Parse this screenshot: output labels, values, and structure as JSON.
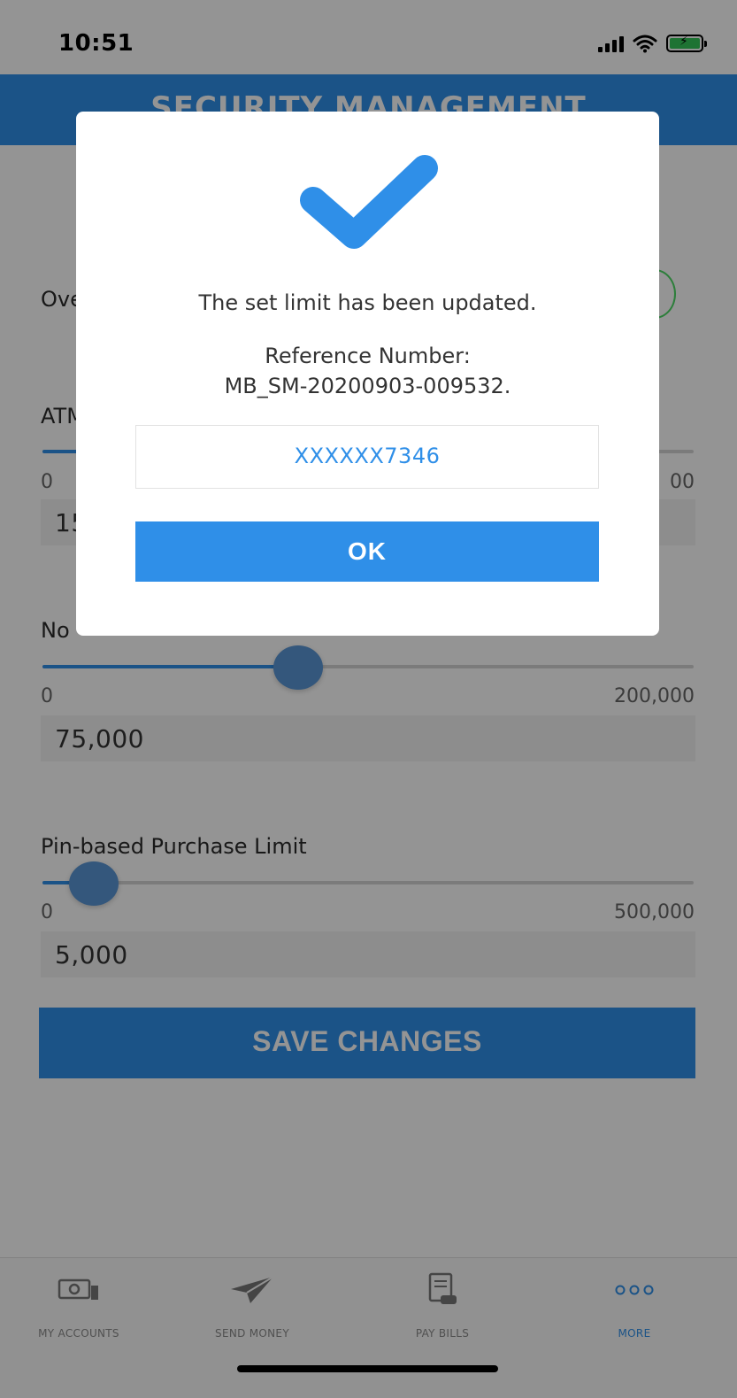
{
  "status_bar": {
    "time": "10:51"
  },
  "header": {
    "title": "SECURITY MANAGEMENT"
  },
  "overall": {
    "label_partial": "Ove"
  },
  "atm": {
    "label_partial": "ATM",
    "min": "0",
    "max_partial": "00",
    "value_partial": "15"
  },
  "no_pin": {
    "label_partial": "No",
    "min": "0",
    "max": "200,000",
    "value": "75,000",
    "fraction": 0.375
  },
  "pin_purchase": {
    "label": "Pin-based Purchase Limit",
    "min": "0",
    "max": "500,000",
    "value": "5,000",
    "fraction": 0.01
  },
  "save_button": {
    "label": "SAVE CHANGES"
  },
  "nav": {
    "items": [
      {
        "label": "MY ACCOUNTS",
        "icon": "money-icon"
      },
      {
        "label": "SEND MONEY",
        "icon": "paper-plane-icon"
      },
      {
        "label": "PAY BILLS",
        "icon": "bill-icon"
      },
      {
        "label": "MORE",
        "icon": "more-dots-icon"
      }
    ]
  },
  "modal": {
    "icon": "checkmark-icon",
    "message": "The set limit has been updated.",
    "ref_label": "Reference Number:",
    "ref_number": "MB_SM-20200903-009532.",
    "account": "XXXXXX7346",
    "ok_label": "OK"
  },
  "colors": {
    "accent": "#2f8fe8",
    "toggle": "#4cd964"
  }
}
